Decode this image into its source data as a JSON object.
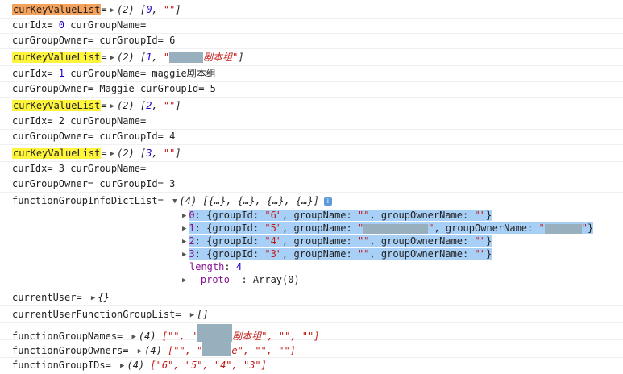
{
  "lines": [
    {
      "label": "curKeyValueList",
      "eq": "=",
      "count": "(2)",
      "open": "[",
      "n": "0",
      "sep": ", ",
      "q1": "\"",
      "q2": "\"",
      "close": "]"
    },
    {
      "text": "curIdx= ",
      "n": "0",
      "rest": " curGroupName="
    },
    {
      "text": "curGroupOwner=  curGroupId= 6"
    },
    {
      "label": "curKeyValueList",
      "eq": "=",
      "count": "(2)",
      "open": "[",
      "n": "1",
      "sep": ", ",
      "q1": "\"",
      "suffix": "剧本组",
      "q2": "\"",
      "close": "]"
    },
    {
      "text": "curIdx= ",
      "n": "1",
      "rest": " curGroupName= maggie剧本组"
    },
    {
      "text": "curGroupOwner= Maggie curGroupId= 5"
    },
    {
      "label": "curKeyValueList",
      "eq": "=",
      "count": "(2)",
      "open": "[",
      "n": "2",
      "sep": ", ",
      "q1": "\"",
      "q2": "\"",
      "close": "]"
    },
    {
      "text": "curIdx= 2 curGroupName="
    },
    {
      "text": "curGroupOwner=  curGroupId= 4"
    },
    {
      "label": "curKeyValueList",
      "eq": "=",
      "count": "(2)",
      "open": "[",
      "n": "3",
      "sep": ", ",
      "q1": "\"",
      "q2": "\"",
      "close": "]"
    },
    {
      "text": "curIdx= 3 curGroupName="
    },
    {
      "text": "curGroupOwner=  curGroupId= 3"
    }
  ],
  "dict": {
    "label": "functionGroupInfoDictList= ",
    "count": "(4)",
    "preview": "[{…}, {…}, {…}, {…}]",
    "info_icon_text": "i",
    "items": [
      {
        "idx": "0",
        "open": ": {groupId: ",
        "gid": "\"6\"",
        "k2": ", groupName: ",
        "gname_a": "\"",
        "gname_b": "\"",
        "k3": ", groupOwnerName: ",
        "gown_a": "\"",
        "gown_b": "\"",
        "close": "}"
      },
      {
        "idx": "1",
        "open": ": {groupId: ",
        "gid": "\"5\"",
        "k2": ", groupName: ",
        "gname_a": "\"",
        "gname_b": "\"",
        "k3": ", groupOwnerName: ",
        "gown_a": "\"",
        "gown_b": "\"",
        "close": "}"
      },
      {
        "idx": "2",
        "open": ": {groupId: ",
        "gid": "\"4\"",
        "k2": ", groupName: ",
        "gname_a": "\"",
        "gname_b": "\"",
        "k3": ", groupOwnerName: ",
        "gown_a": "\"",
        "gown_b": "\"",
        "close": "}"
      },
      {
        "idx": "3",
        "open": ": {groupId: ",
        "gid": "\"3\"",
        "k2": ", groupName: ",
        "gname_a": "\"",
        "gname_b": "\"",
        "k3": ", groupOwnerName: ",
        "gown_a": "\"",
        "gown_b": "\"",
        "close": "}"
      }
    ],
    "length_key": "length",
    "length_val": "4",
    "proto_key": "__proto__",
    "proto_val": ": Array(0)"
  },
  "tail": {
    "currentUser_label": "currentUser= ",
    "currentUser_val": "{}",
    "cufgl_label": "currentUserFunctionGroupList= ",
    "cufgl_val": "[]",
    "names_label": "functionGroupNames= ",
    "names_count": "(4)",
    "names_open": "[\"\", \"",
    "names_suffix": "剧本组",
    "names_rest": "\", \"\", \"\"]",
    "owners_label": "functionGroupOwners= ",
    "owners_count": "(4)",
    "owners_open": "[\"\", \"",
    "owners_suffix": "e",
    "owners_rest": "\", \"\", \"\"]",
    "ids_label": "functionGroupIDs= ",
    "ids_count": "(4)",
    "ids_val": "[\"6\", \"5\", \"4\", \"3\"]"
  },
  "colors": {
    "highlight_orange": "#f4a15c",
    "highlight_yellow": "#fef43c",
    "selection": "#a8cff5",
    "redaction": "#98b0bd",
    "number": "#1c00cf",
    "string": "#c41a16",
    "key": "#881391"
  }
}
